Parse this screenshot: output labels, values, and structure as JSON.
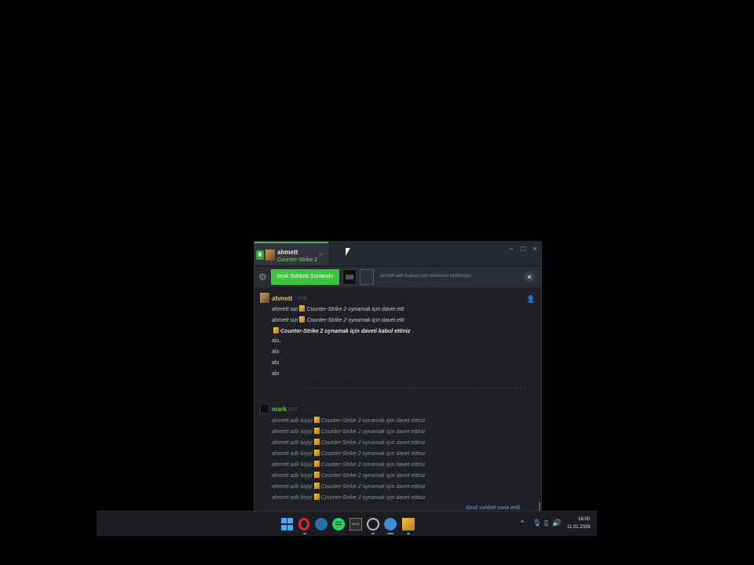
{
  "window": {
    "tab_name": "ahmett",
    "tab_game": "Counter-Strike 2",
    "tab_close": "×",
    "controls": {
      "minimize": "–",
      "maximize": "□",
      "close": "×"
    }
  },
  "voice_bar": {
    "end_button": "Sesli Sohbeti Sonlandır",
    "waiting": "ahmett adlı kullanıcının katılması bekleniyor",
    "close": "×"
  },
  "messages": {
    "group1": {
      "author": "ahmett",
      "time": "14:08",
      "lines": [
        "ahmett sizi",
        "Counter-Strike 2 oynamak için davet etti",
        "ahmett sizi",
        "Counter-Strike 2 oynamak için davet etti",
        "Counter-Strike 2 oynamak için daveti kabul ettiniz",
        "alo,",
        "alo",
        "alo",
        "alo"
      ]
    },
    "group2": {
      "author": "mark",
      "time": "15:22",
      "prefix": "ahmett adlı kişiyi",
      "invite": "Counter-Strike 2 oynamak için davet ettiniz"
    },
    "voice_ended": "Sesli sohbet sona erdi."
  },
  "taskbar": {
    "time": "16:00",
    "date": "11.01.2026",
    "epic_label": "EPIC",
    "tray_chevron": "^",
    "volume_icon": "🔊"
  },
  "colors": {
    "accent_green": "#3fc240",
    "game_green": "#8fce5c",
    "mark_green": "#6fbf3f",
    "link_blue": "#6fa8dc"
  }
}
